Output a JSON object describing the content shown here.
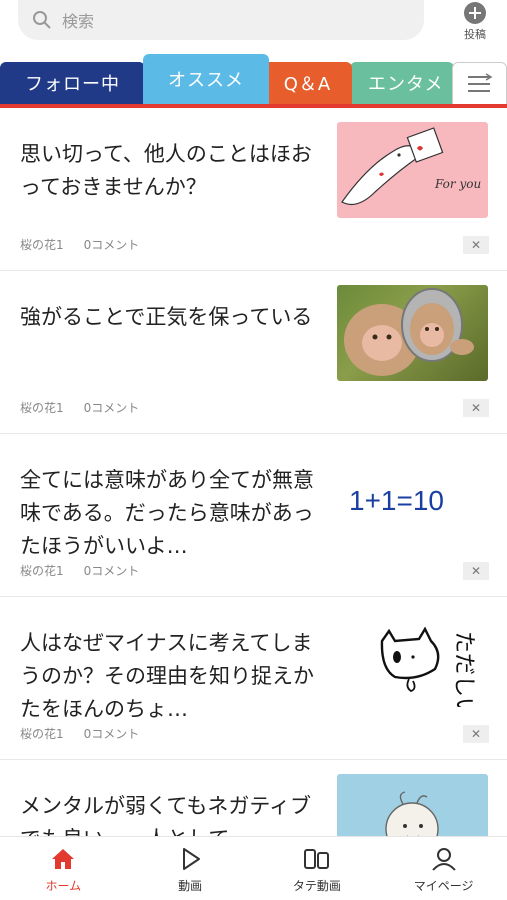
{
  "header": {
    "search_placeholder": "検索",
    "post_label": "投稿"
  },
  "tabs": [
    {
      "label": "フォロー中",
      "color": "#213a87"
    },
    {
      "label": "オススメ",
      "color": "#5bbbe6",
      "active": true
    },
    {
      "label": "Q＆A",
      "color": "#e75d2c"
    },
    {
      "label": "エンタメ",
      "color": "#6abf9f"
    }
  ],
  "feed": [
    {
      "title": "思い切って、他人のことはほおっておきませんか？",
      "author": "桜の花1",
      "comments": "0コメント",
      "thumb": "pink-illustration",
      "thumb_text": "For you"
    },
    {
      "title": "強がることで正気を保っている",
      "author": "桜の花1",
      "comments": "0コメント",
      "thumb": "monkey-mirror-photo"
    },
    {
      "title": "全てには意味があり全てが無意味である。だったら意味があったほうがいいよ…",
      "author": "桜の花1",
      "comments": "0コメント",
      "thumb": "math-text",
      "thumb_text": "1+1=10"
    },
    {
      "title": "人はなぜマイナスに考えてしまうのか？その理由を知り捉えかたをほんのちょ…",
      "author": "桜の花1",
      "comments": "0コメント",
      "thumb": "doodle-drawing",
      "thumb_text": "ただしい"
    },
    {
      "title": "メンタルが弱くてもネガティブでも良い。一人として",
      "author": "",
      "comments": "",
      "thumb": "blue-character"
    }
  ],
  "bottom_nav": [
    {
      "label": "ホーム",
      "icon": "home-icon",
      "active": true
    },
    {
      "label": "動画",
      "icon": "play-icon"
    },
    {
      "label": "タテ動画",
      "icon": "vertical-video-icon"
    },
    {
      "label": "マイページ",
      "icon": "person-icon"
    }
  ],
  "colors": {
    "accent": "#e23a2e"
  }
}
